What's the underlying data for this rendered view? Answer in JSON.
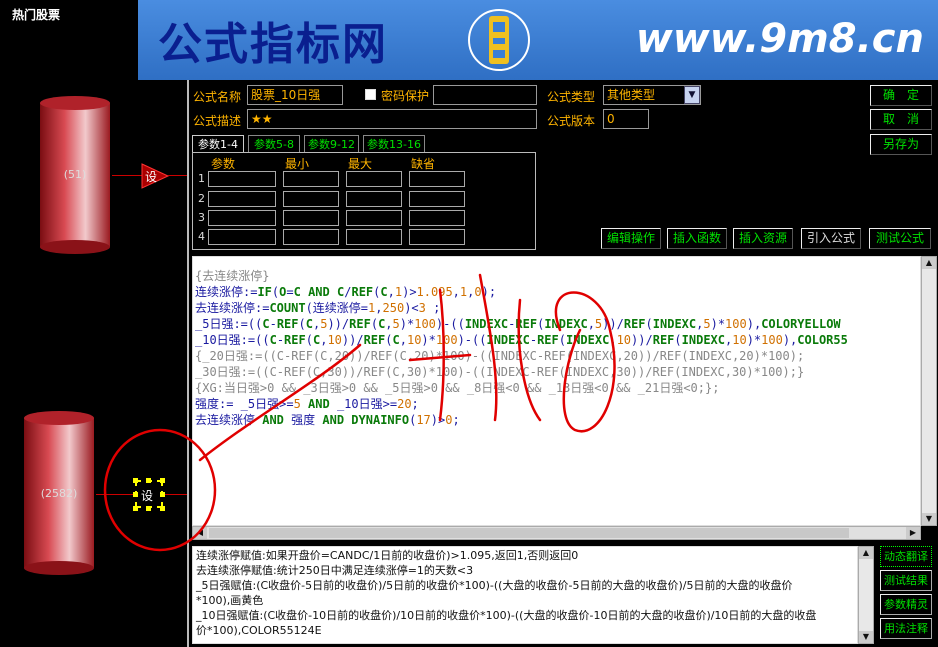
{
  "left_panel": {
    "title": "热门股票",
    "nodes": [
      {
        "count": "(51)",
        "set_label": "设"
      },
      {
        "count": "(2582)",
        "set_label": "设"
      }
    ]
  },
  "banner": {
    "left_text": "公式指标网",
    "right_text": "www.9m8.cn",
    "logo_text": "www.9m8.cn",
    "colors": {
      "bg": "#3a7fd6",
      "left_text": "#0a1f8f",
      "right_text": "#ffffff"
    }
  },
  "form": {
    "name_label": "公式名称",
    "name_value": "股票_10日强",
    "password_label": "密码保护",
    "password_value": "",
    "desc_label": "公式描述",
    "desc_value": "★★",
    "type_label": "公式类型",
    "type_value": "其他类型",
    "version_label": "公式版本",
    "version_value": "0"
  },
  "right_buttons": {
    "ok": "确　定",
    "cancel": "取　消",
    "save_as": "另存为"
  },
  "tabs": [
    "参数1-4",
    "参数5-8",
    "参数9-12",
    "参数13-16"
  ],
  "params": {
    "headers": [
      "参数",
      "最小",
      "最大",
      "缺省"
    ],
    "rows": [
      "1",
      "2",
      "3",
      "4"
    ]
  },
  "toolbar": {
    "edit_ops": "编辑操作",
    "insert_func": "插入函数",
    "insert_res": "插入资源",
    "import_formula": "引入公式",
    "test_formula": "测试公式"
  },
  "code_lines": [
    {
      "segments": [
        {
          "t": "{去连续涨停}",
          "c": "cmt"
        }
      ]
    },
    {
      "segments": [
        {
          "t": "连续涨停:=",
          "c": "def"
        },
        {
          "t": "IF",
          "c": "fn"
        },
        {
          "t": "(",
          "c": "def"
        },
        {
          "t": "O",
          "c": "fn"
        },
        {
          "t": "=",
          "c": "def"
        },
        {
          "t": "C",
          "c": "fn"
        },
        {
          "t": " ",
          "c": "def"
        },
        {
          "t": "AND",
          "c": "fn"
        },
        {
          "t": " ",
          "c": "def"
        },
        {
          "t": "C",
          "c": "fn"
        },
        {
          "t": "/",
          "c": "def"
        },
        {
          "t": "REF",
          "c": "fn"
        },
        {
          "t": "(",
          "c": "def"
        },
        {
          "t": "C",
          "c": "fn"
        },
        {
          "t": ",",
          "c": "def"
        },
        {
          "t": "1",
          "c": "num"
        },
        {
          "t": ")>",
          "c": "def"
        },
        {
          "t": "1.095",
          "c": "num"
        },
        {
          "t": ",",
          "c": "def"
        },
        {
          "t": "1",
          "c": "num"
        },
        {
          "t": ",",
          "c": "def"
        },
        {
          "t": "0",
          "c": "num"
        },
        {
          "t": ");",
          "c": "def"
        }
      ]
    },
    {
      "segments": [
        {
          "t": "去连续涨停:=",
          "c": "def"
        },
        {
          "t": "COUNT",
          "c": "fn"
        },
        {
          "t": "(连续涨停=",
          "c": "def"
        },
        {
          "t": "1",
          "c": "num"
        },
        {
          "t": ",",
          "c": "def"
        },
        {
          "t": "250",
          "c": "num"
        },
        {
          "t": ")<",
          "c": "def"
        },
        {
          "t": "3",
          "c": "num"
        },
        {
          "t": " ;",
          "c": "def"
        }
      ]
    },
    {
      "segments": [
        {
          "t": "_5日强:=((",
          "c": "def"
        },
        {
          "t": "C",
          "c": "fn"
        },
        {
          "t": "-",
          "c": "def"
        },
        {
          "t": "REF",
          "c": "fn"
        },
        {
          "t": "(",
          "c": "def"
        },
        {
          "t": "C",
          "c": "fn"
        },
        {
          "t": ",",
          "c": "def"
        },
        {
          "t": "5",
          "c": "num"
        },
        {
          "t": "))/",
          "c": "def"
        },
        {
          "t": "REF",
          "c": "fn"
        },
        {
          "t": "(",
          "c": "def"
        },
        {
          "t": "C",
          "c": "fn"
        },
        {
          "t": ",",
          "c": "def"
        },
        {
          "t": "5",
          "c": "num"
        },
        {
          "t": ")*",
          "c": "def"
        },
        {
          "t": "100",
          "c": "num"
        },
        {
          "t": ")-((",
          "c": "def"
        },
        {
          "t": "INDEXC",
          "c": "fn"
        },
        {
          "t": "-",
          "c": "def"
        },
        {
          "t": "REF",
          "c": "fn"
        },
        {
          "t": "(",
          "c": "def"
        },
        {
          "t": "INDEXC",
          "c": "fn"
        },
        {
          "t": ",",
          "c": "def"
        },
        {
          "t": "5",
          "c": "num"
        },
        {
          "t": "))/",
          "c": "def"
        },
        {
          "t": "REF",
          "c": "fn"
        },
        {
          "t": "(",
          "c": "def"
        },
        {
          "t": "INDEXC",
          "c": "fn"
        },
        {
          "t": ",",
          "c": "def"
        },
        {
          "t": "5",
          "c": "num"
        },
        {
          "t": ")*",
          "c": "def"
        },
        {
          "t": "100",
          "c": "num"
        },
        {
          "t": "),",
          "c": "def"
        },
        {
          "t": "COLORYELLOW",
          "c": "fn"
        }
      ]
    },
    {
      "segments": [
        {
          "t": "_10日强:=((",
          "c": "def"
        },
        {
          "t": "C",
          "c": "fn"
        },
        {
          "t": "-",
          "c": "def"
        },
        {
          "t": "REF",
          "c": "fn"
        },
        {
          "t": "(",
          "c": "def"
        },
        {
          "t": "C",
          "c": "fn"
        },
        {
          "t": ",",
          "c": "def"
        },
        {
          "t": "10",
          "c": "num"
        },
        {
          "t": "))/",
          "c": "def"
        },
        {
          "t": "REF",
          "c": "fn"
        },
        {
          "t": "(",
          "c": "def"
        },
        {
          "t": "C",
          "c": "fn"
        },
        {
          "t": ",",
          "c": "def"
        },
        {
          "t": "10",
          "c": "num"
        },
        {
          "t": ")*",
          "c": "def"
        },
        {
          "t": "100",
          "c": "num"
        },
        {
          "t": ")-((",
          "c": "def"
        },
        {
          "t": "INDEXC",
          "c": "fn"
        },
        {
          "t": "-",
          "c": "def"
        },
        {
          "t": "REF",
          "c": "fn"
        },
        {
          "t": "(",
          "c": "def"
        },
        {
          "t": "INDEXC",
          "c": "fn"
        },
        {
          "t": ",",
          "c": "def"
        },
        {
          "t": "10",
          "c": "num"
        },
        {
          "t": "))/",
          "c": "def"
        },
        {
          "t": "REF",
          "c": "fn"
        },
        {
          "t": "(",
          "c": "def"
        },
        {
          "t": "INDEXC",
          "c": "fn"
        },
        {
          "t": ",",
          "c": "def"
        },
        {
          "t": "10",
          "c": "num"
        },
        {
          "t": ")*",
          "c": "def"
        },
        {
          "t": "100",
          "c": "num"
        },
        {
          "t": "),",
          "c": "def"
        },
        {
          "t": "COLOR55",
          "c": "fn"
        }
      ]
    },
    {
      "segments": [
        {
          "t": "{_20日强:=((C-REF(C,20))/REF(C,20)*100)-((INDEXC-REF(INDEXC,20))/REF(INDEXC,20)*100);",
          "c": "cmt"
        }
      ]
    },
    {
      "segments": [
        {
          "t": " _30日强:=((C-REF(C,30))/REF(C,30)*100)-((INDEXC-REF(INDEXC,30))/REF(INDEXC,30)*100);}",
          "c": "cmt"
        }
      ]
    },
    {
      "segments": [
        {
          "t": "{XG:当日强>0 && _3日强>0 && _5日强>0 && _8日强<0 && _13日强<0 && _21日强<0;};",
          "c": "cmt"
        }
      ]
    },
    {
      "segments": [
        {
          "t": "强度:=  _5日强>=",
          "c": "def"
        },
        {
          "t": "5",
          "c": "num"
        },
        {
          "t": " ",
          "c": "def"
        },
        {
          "t": "AND",
          "c": "fn"
        },
        {
          "t": " _10日强>=",
          "c": "def"
        },
        {
          "t": "20",
          "c": "num"
        },
        {
          "t": ";",
          "c": "def"
        }
      ]
    },
    {
      "segments": [
        {
          "t": "去连续涨停 ",
          "c": "def"
        },
        {
          "t": "AND",
          "c": "fn"
        },
        {
          "t": " 强度   ",
          "c": "def"
        },
        {
          "t": "AND",
          "c": "fn"
        },
        {
          "t": " ",
          "c": "def"
        },
        {
          "t": "DYNAINFO",
          "c": "fn"
        },
        {
          "t": "(",
          "c": "def"
        },
        {
          "t": "17",
          "c": "num"
        },
        {
          "t": ")>",
          "c": "def"
        },
        {
          "t": "0",
          "c": "num"
        },
        {
          "t": ";",
          "c": "def"
        }
      ]
    }
  ],
  "help_lines": [
    "连续涨停赋值:如果开盘价=CANDC/1日前的收盘价)>1.095,返回1,否则返回0",
    "去连续涨停赋值:统计250日中满足连续涨停=1的天数<3",
    "_5日强赋值:(C收盘价-5日前的收盘价)/5日前的收盘价*100)-((大盘的收盘价-5日前的大盘的收盘价)/5日前的大盘的收盘价",
    "*100),画黄色",
    "_10日强赋值:(C收盘价-10日前的收盘价)/10日前的收盘价*100)-((大盘的收盘价-10日前的大盘的收盘价)/10日前的大盘的收盘",
    "价*100),COLOR55124E"
  ],
  "side_buttons": [
    "动态翻译",
    "测试结果",
    "参数精灵",
    "用法注释"
  ],
  "annotation": {
    "color": "#e00000"
  }
}
